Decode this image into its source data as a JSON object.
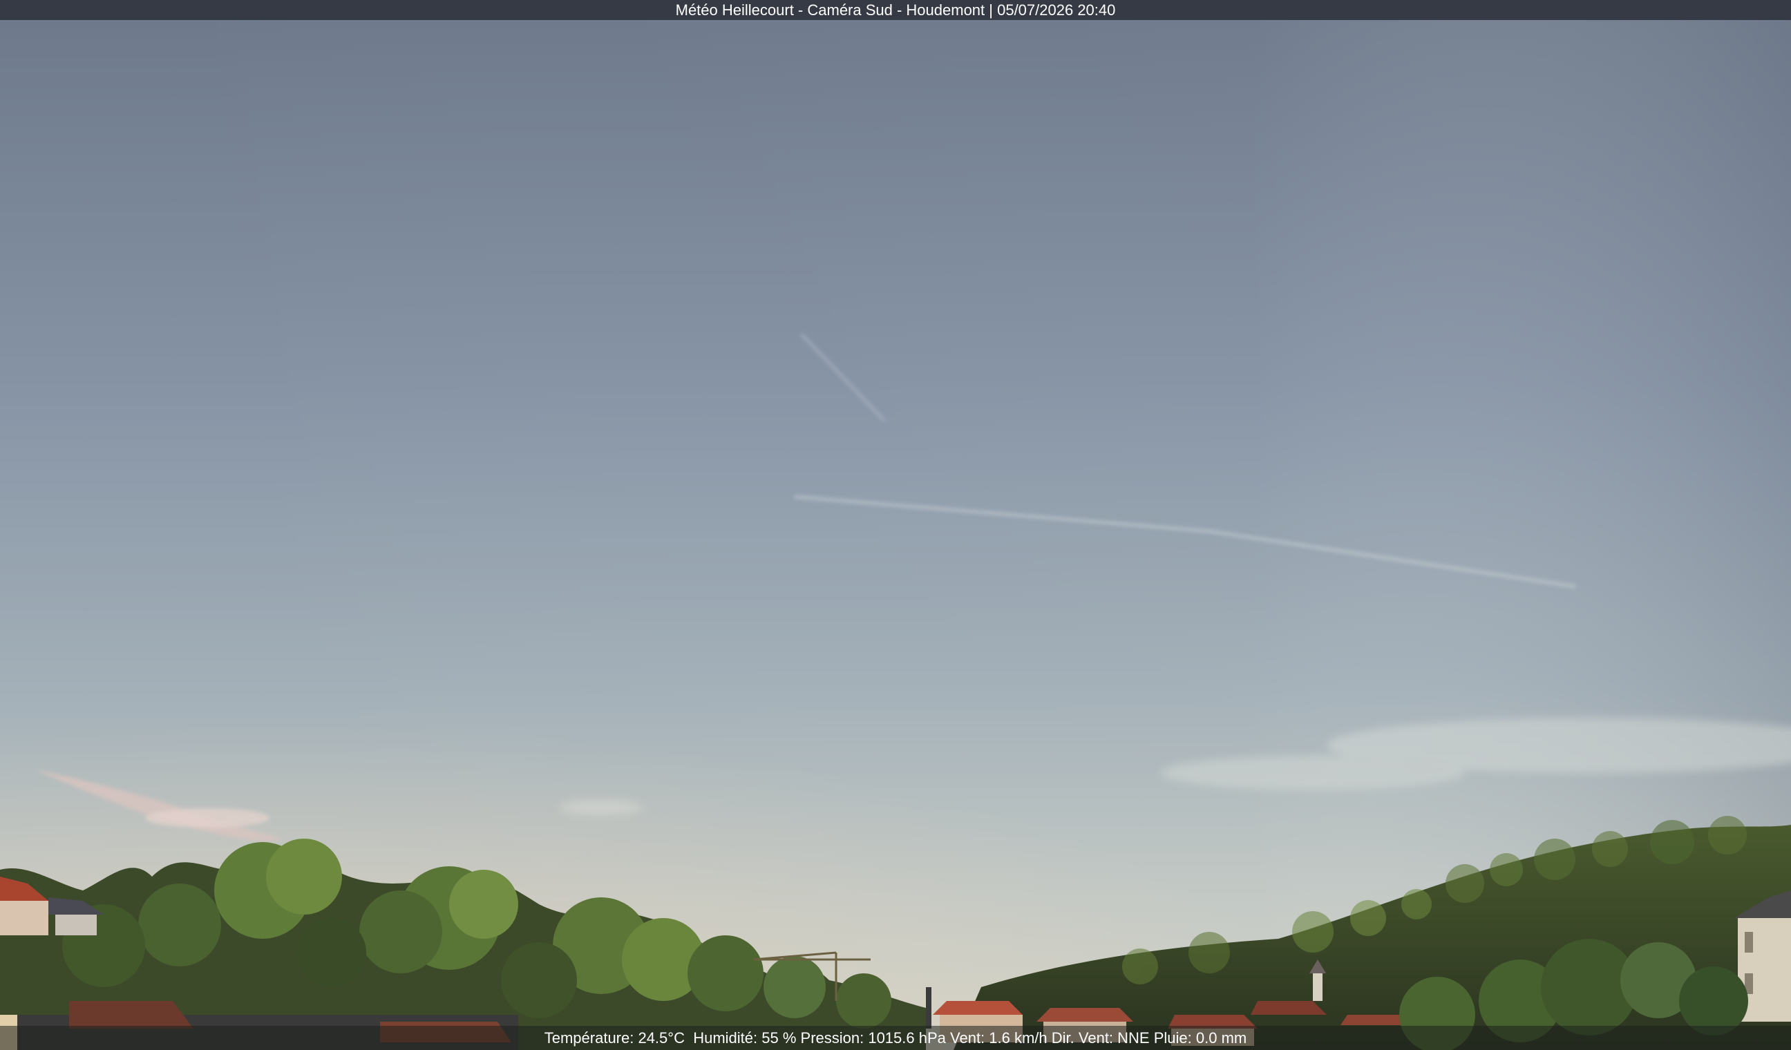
{
  "overlay": {
    "title": "Météo Heillecourt - Caméra Sud - Houdemont | 05/07/2026 20:40",
    "weather": {
      "temperature": "Température: 24.5°C",
      "humidity": "Humidité: 55 %",
      "pressure": "Pression: 1015.6 hPa",
      "wind": "Vent: 1.6 km/h",
      "wind_direction": "Dir. Vent: NNE",
      "rain": "Pluie: 0.0 mm"
    }
  },
  "colors": {
    "sky_top": "#6f7b8e",
    "sky_mid": "#8d9cab",
    "sky_horizon": "#c8cdc8",
    "trees_dark": "#2f3a22",
    "trees_light": "#6b8a3a",
    "roof": "#b5503a",
    "bar": "#353a44"
  }
}
